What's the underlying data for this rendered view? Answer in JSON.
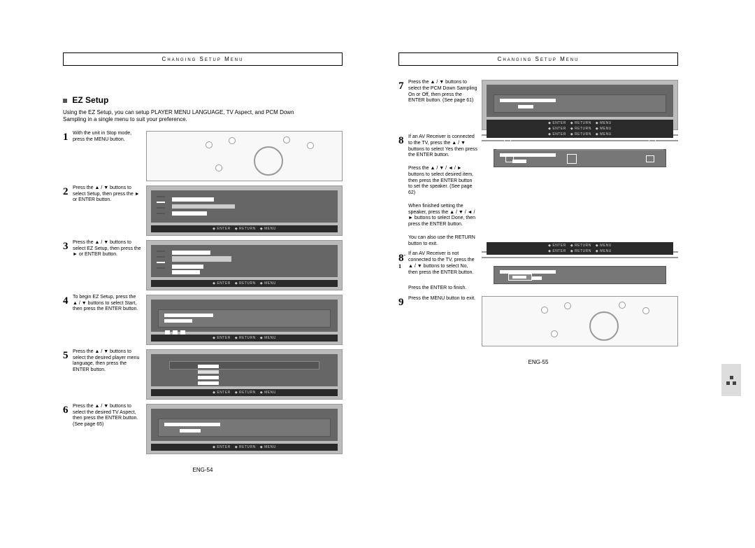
{
  "header": {
    "title_left": "Changing Setup Menu",
    "title_right": "Changing Setup Menu"
  },
  "section": {
    "title": "EZ Setup",
    "intro1": "Using the EZ Setup, you can setup PLAYER MENU LANGUAGE, TV Aspect, and PCM Down",
    "intro2": "Sampling in a single menu to suit your preference."
  },
  "steps_left": [
    {
      "num": "1",
      "text": "With the unit in Stop mode, press the MENU button.",
      "type": "remote"
    },
    {
      "num": "2",
      "text": "Press the ▲ / ▼ buttons to select Setup, then press the ► or ENTER button.",
      "type": "menu"
    },
    {
      "num": "3",
      "text": "Press the ▲ / ▼ buttons to select EZ Setup, then press the ► or ENTER button.",
      "type": "menu"
    },
    {
      "num": "4",
      "text": "To begin EZ Setup, press the ▲ / ▼ buttons to select Start, then press the ENTER button.",
      "type": "panel"
    },
    {
      "num": "5",
      "text": "Press the ▲ / ▼ buttons to select the desired player menu language, then press the ENTER button.",
      "type": "panel"
    },
    {
      "num": "6",
      "text": "Press the ▲ / ▼ buttons to select the desired TV Aspect, then press the ENTER button. (See page 65)",
      "type": "panel"
    }
  ],
  "steps_right": [
    {
      "num": "7",
      "text": "Press the ▲ / ▼ buttons to select the PCM Down Sampling On or Off, then press the ENTER button. (See page 61)",
      "type": "panel"
    },
    {
      "num": "8",
      "text": "If an AV Receiver is connected to the TV, press the ▲ / ▼ buttons to select Yes then press the ENTER button.",
      "type": "panel"
    },
    {
      "num": "",
      "text": "Press the ▲ / ▼ / ◄ / ► buttons to select desired item, then press the ENTER button to set the speaker. (See page 62)",
      "type": "popup"
    },
    {
      "num": "",
      "text": "When finished setting the speaker, press the ▲ / ▼ / ◄ / ► buttons to select Done, then press the ENTER button.",
      "type": "none"
    },
    {
      "num": "",
      "text": "You can also use the RETURN button to exit.",
      "type": "none"
    },
    {
      "num": "8-1",
      "sup": "-1",
      "base": "8",
      "text": "If an AV Receiver is not connected to the TV, press the ▲ / ▼ buttons to select No, then press the ENTER button.",
      "type": "panel"
    },
    {
      "num": "",
      "text": "Press the ENTER to finish.",
      "type": "panel-low"
    },
    {
      "num": "9",
      "text": "Press the MENU button to exit.",
      "type": "remote"
    }
  ],
  "footer_bar": {
    "enter": "ENTER",
    "return": "RETURN",
    "menu": "MENU"
  },
  "pagenum_left": "ENG-54",
  "pagenum_right": "ENG-55"
}
